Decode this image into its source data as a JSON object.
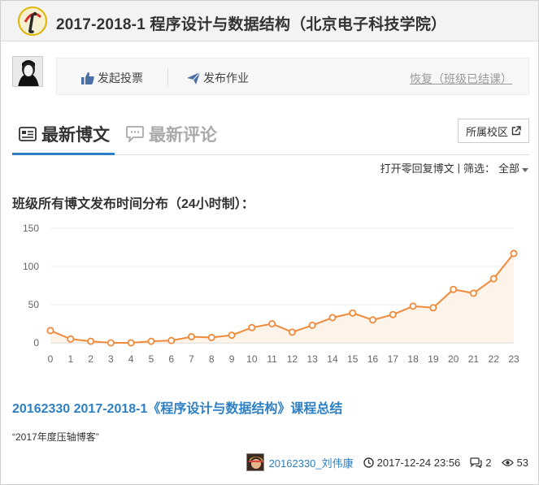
{
  "header": {
    "title": "2017-2018-1 程序设计与数据结构（北京电子科技学院）"
  },
  "actions": {
    "vote_label": "发起投票",
    "homework_label": "发布作业",
    "restore_label": "恢复（班级已结课）"
  },
  "tabs": {
    "latest_blogs": "最新博文",
    "latest_comments": "最新评论",
    "campus_button": "所属校区"
  },
  "filter": {
    "open_zero_reply": "打开零回复博文",
    "separator": "|",
    "filter_label": "筛选：",
    "filter_value": "全部"
  },
  "chart_title": "班级所有博文发布时间分布（24小时制）：",
  "chart_data": {
    "type": "area",
    "x": [
      0,
      1,
      2,
      3,
      4,
      5,
      6,
      7,
      8,
      9,
      10,
      11,
      12,
      13,
      14,
      15,
      16,
      17,
      18,
      19,
      20,
      21,
      22,
      23
    ],
    "series": [
      {
        "values": [
          16,
          5,
          2,
          0,
          0,
          2,
          3,
          8,
          7,
          10,
          20,
          25,
          14,
          23,
          33,
          39,
          30,
          37,
          48,
          46,
          70,
          65,
          84,
          117
        ]
      }
    ],
    "xlabel": "",
    "ylabel": "",
    "ylim": [
      0,
      150
    ],
    "yticks": [
      0,
      50,
      100,
      150
    ],
    "grid": true,
    "color": "#f08a3a"
  },
  "post": {
    "title": "20162330 2017-2018-1《程序设计与数据结构》课程总结",
    "excerpt": "“2017年度压轴博客”",
    "author": "20162330_刘伟康",
    "datetime": "2017-12-24 23:56",
    "comments": "2",
    "views": "53"
  },
  "colors": {
    "accent": "#2e80c5",
    "chart_line": "#f08a3a",
    "header_bg": "#f3f3f3"
  },
  "icons": {
    "logo": "site-logo",
    "vote": "thumbs-up-icon",
    "homework": "paper-plane-icon",
    "blogs": "blog-card-icon",
    "comments": "comment-bubble-icon",
    "external": "external-link-icon",
    "clock": "clock-icon",
    "comment_count": "comments-icon",
    "views": "eye-icon"
  }
}
